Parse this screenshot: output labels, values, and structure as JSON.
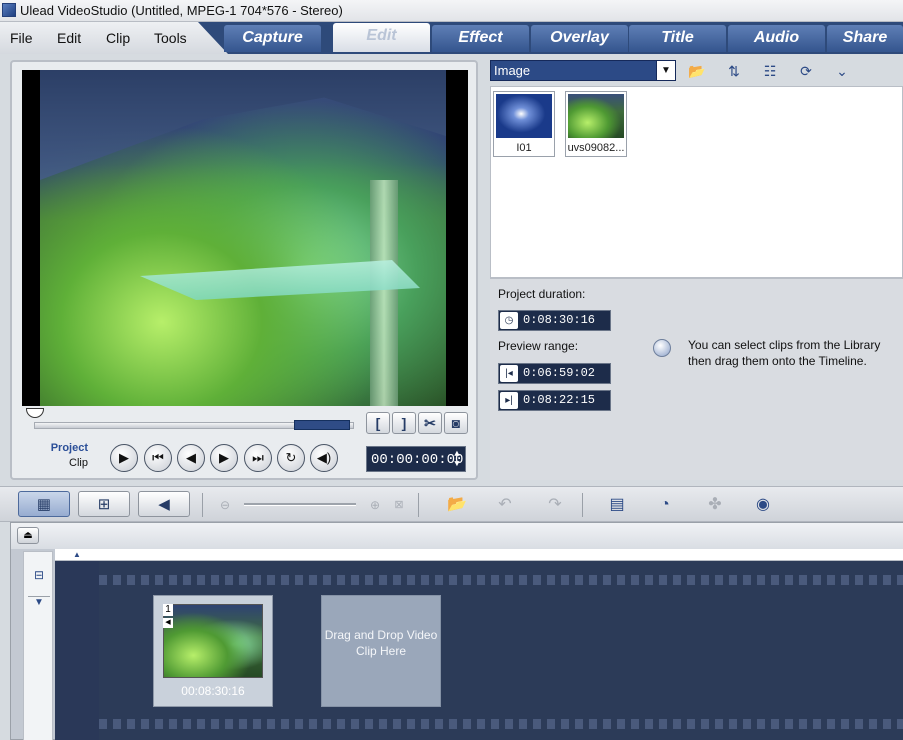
{
  "window": {
    "title": "Ulead VideoStudio (Untitled, MPEG-1 704*576 - Stereo)"
  },
  "menu": {
    "items": [
      "File",
      "Edit",
      "Clip",
      "Tools"
    ]
  },
  "tabs": [
    "Capture",
    "Edit",
    "Effect",
    "Overlay",
    "Title",
    "Audio",
    "Share"
  ],
  "active_tab": "Edit",
  "preview": {
    "mark_in_label": "[",
    "mark_out_label": "]",
    "project_label": "Project",
    "clip_label": "Clip",
    "timecode": "00:00:00:00"
  },
  "library": {
    "category": "Image",
    "items": [
      {
        "name": "I01"
      },
      {
        "name": "uvs09082..."
      }
    ]
  },
  "info": {
    "project_duration_label": "Project duration:",
    "project_duration": "0:08:30:16",
    "preview_range_label": "Preview range:",
    "range_start": "0:06:59:02",
    "range_end": "0:08:22:15",
    "hint": "You can select clips from the Library then drag them onto the Timeline."
  },
  "timeline": {
    "clips": [
      {
        "index": "1",
        "duration": "00:08:30:16"
      }
    ],
    "drop_placeholder": "Drag and Drop Video Clip Here"
  },
  "colors": {
    "accent": "#2c4a86",
    "tab_blue": "#34558e",
    "timecode_bg": "#1d2c4a",
    "storyboard_bg": "#2c3b58"
  },
  "icons": {
    "toolbar": [
      "storyboard-view-icon",
      "timeline-view-icon",
      "audio-view-icon",
      "zoom-out-icon",
      "zoom-in-icon",
      "fit-project-icon",
      "insert-media-icon",
      "undo-icon",
      "redo-icon",
      "smart-render-icon",
      "project-duration-icon",
      "mixer-icon",
      "surround-51-icon"
    ]
  }
}
